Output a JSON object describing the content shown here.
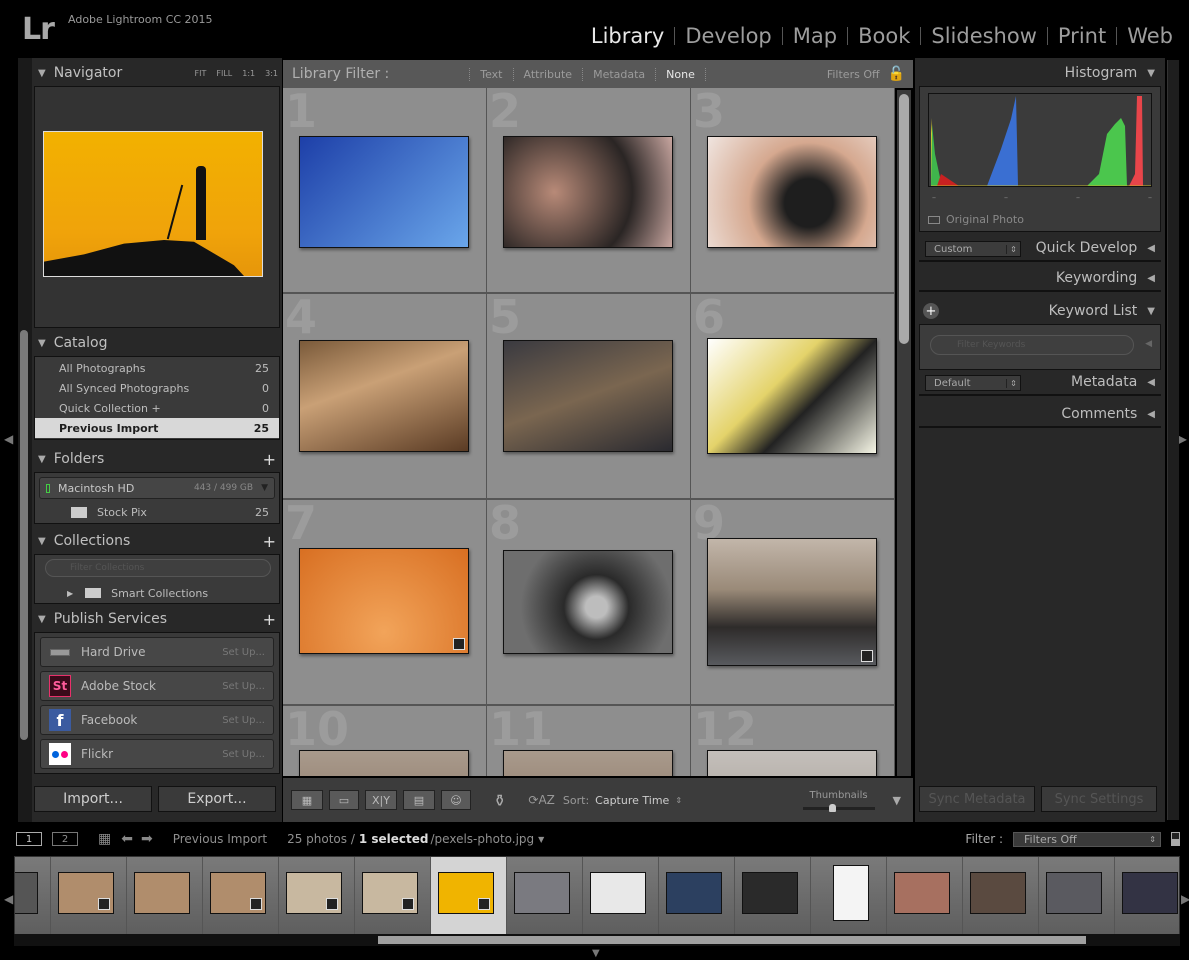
{
  "app": {
    "logo": "Lr",
    "title": "Adobe Lightroom CC 2015"
  },
  "modules": [
    {
      "label": "Library",
      "active": true
    },
    {
      "label": "Develop"
    },
    {
      "label": "Map"
    },
    {
      "label": "Book"
    },
    {
      "label": "Slideshow"
    },
    {
      "label": "Print"
    },
    {
      "label": "Web"
    }
  ],
  "navigator": {
    "title": "Navigator",
    "zoom_options": [
      "FIT",
      "FILL",
      "1:1",
      "3:1"
    ]
  },
  "catalog": {
    "title": "Catalog",
    "items": [
      {
        "label": "All Photographs",
        "count": "25"
      },
      {
        "label": "All Synced Photographs",
        "count": "0"
      },
      {
        "label": "Quick Collection +",
        "count": "0"
      },
      {
        "label": "Previous Import",
        "count": "25",
        "selected": true
      }
    ]
  },
  "folders": {
    "title": "Folders",
    "volume": {
      "name": "Macintosh HD",
      "usage": "443 / 499 GB"
    },
    "items": [
      {
        "label": "Stock Pix",
        "count": "25"
      }
    ]
  },
  "collections": {
    "title": "Collections",
    "filter_placeholder": "Filter Collections",
    "items": [
      {
        "label": "Smart Collections"
      }
    ]
  },
  "publish": {
    "title": "Publish Services",
    "services": [
      {
        "name": "Hard Drive",
        "action": "Set Up..."
      },
      {
        "name": "Adobe Stock",
        "action": "Set Up...",
        "icon": "St"
      },
      {
        "name": "Facebook",
        "action": "Set Up...",
        "icon": "f"
      },
      {
        "name": "Flickr",
        "action": "Set Up..."
      }
    ]
  },
  "left_buttons": {
    "import": "Import...",
    "export": "Export..."
  },
  "library_filter": {
    "title": "Library Filter :",
    "options": [
      "Text",
      "Attribute",
      "Metadata",
      "None"
    ],
    "active": "None",
    "preset": "Filters Off"
  },
  "grid": {
    "cells": [
      "1",
      "2",
      "3",
      "4",
      "5",
      "6",
      "7",
      "8",
      "9",
      "10",
      "11",
      "12"
    ]
  },
  "toolbar": {
    "sort_label": "Sort:",
    "sort_value": "Capture Time",
    "thumbnails_label": "Thumbnails",
    "thumbnail_size": 0.4
  },
  "right": {
    "histogram": {
      "title": "Histogram",
      "original_photo": "Original Photo"
    },
    "quick_develop": {
      "title": "Quick Develop",
      "preset": "Custom"
    },
    "keywording": {
      "title": "Keywording"
    },
    "keyword_list": {
      "title": "Keyword List",
      "filter_placeholder": "Filter Keywords"
    },
    "metadata": {
      "title": "Metadata",
      "preset": "Default"
    },
    "comments": {
      "title": "Comments"
    },
    "sync_metadata": "Sync Metadata",
    "sync_settings": "Sync Settings"
  },
  "filmstrip_bar": {
    "views": [
      "1",
      "2"
    ],
    "source": "Previous Import",
    "count": "25 photos /",
    "selected": "1 selected",
    "filename": "/pexels-photo.jpg",
    "filter_label": "Filter :",
    "filter_value": "Filters Off"
  },
  "colors": {
    "accent_selected": "#d8d8d8",
    "background": "#000000",
    "panel": "#282828",
    "grid": "#8c8c8c"
  }
}
